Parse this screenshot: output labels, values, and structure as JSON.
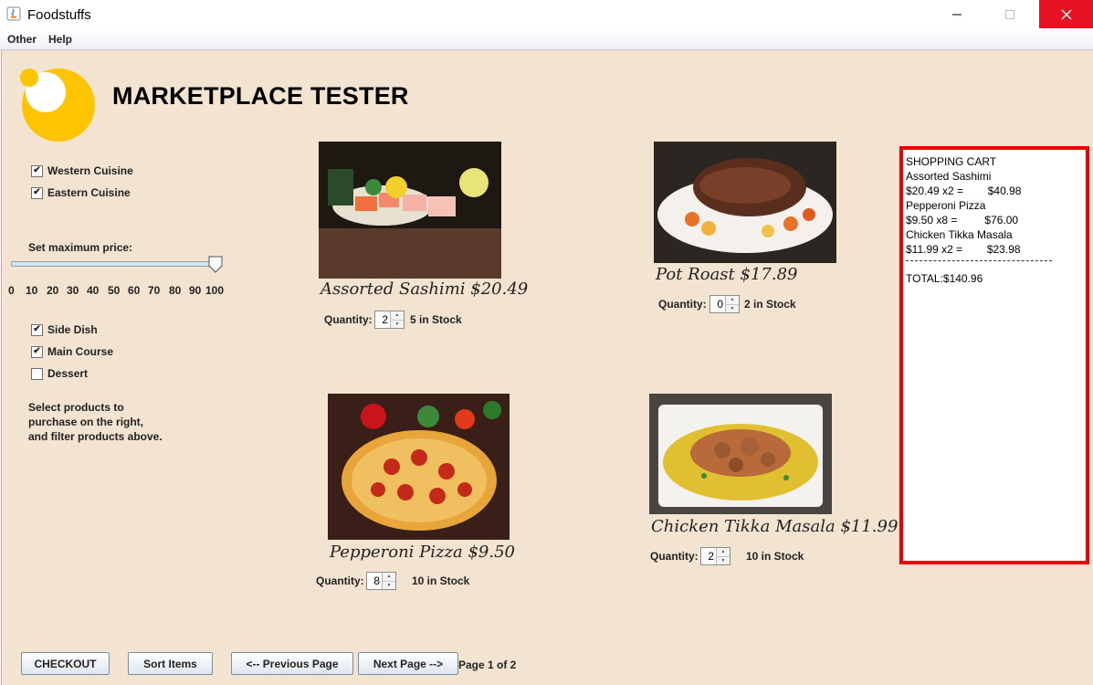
{
  "window": {
    "title": "Foodstuffs"
  },
  "menu": [
    {
      "label": "Other"
    },
    {
      "label": "Help"
    }
  ],
  "header": {
    "title": "MARKETPLACE TESTER"
  },
  "filters": {
    "cuisine": [
      {
        "label": "Western Cuisine",
        "checked": true
      },
      {
        "label": "Eastern Cuisine",
        "checked": true
      }
    ],
    "price_label": "Set maximum price:",
    "price_slider": {
      "min": 0,
      "max": 100,
      "value": 100,
      "ticks": [
        "0",
        "10",
        "20",
        "30",
        "40",
        "50",
        "60",
        "70",
        "80",
        "90",
        "100"
      ]
    },
    "course": [
      {
        "label": "Side Dish",
        "checked": true
      },
      {
        "label": "Main Course",
        "checked": true
      },
      {
        "label": "Dessert",
        "checked": false
      }
    ],
    "help_text": "Select products to\npurchase on the right,\nand filter products above."
  },
  "products": [
    {
      "name": "Assorted Sashimi $20.49",
      "quantity_label": "Quantity:",
      "quantity": "2",
      "stock": "5 in Stock"
    },
    {
      "name": "Pot Roast $17.89",
      "quantity_label": "Quantity:",
      "quantity": "0",
      "stock": "2 in Stock"
    },
    {
      "name": "Pepperoni Pizza $9.50",
      "quantity_label": "Quantity:",
      "quantity": "8",
      "stock": "10 in Stock"
    },
    {
      "name": "Chicken Tikka Masala $11.99",
      "quantity_label": "Quantity:",
      "quantity": "2",
      "stock": "10 in Stock"
    }
  ],
  "cart": {
    "lines": [
      "SHOPPING CART",
      "Assorted Sashimi",
      "$20.49 x2 =        $40.98",
      "Pepperoni Pizza",
      "$9.50 x8 =         $76.00",
      "Chicken Tikka Masala",
      "$11.99 x2 =        $23.98"
    ],
    "total": "TOTAL:$140.96",
    "border_color": "#ee0000"
  },
  "footer": {
    "checkout": "CHECKOUT",
    "sort": "Sort Items",
    "prev": "<-- Previous Page",
    "next": "Next Page -->",
    "page": "Page 1 of 2"
  },
  "colors": {
    "background": "#f3e4d1",
    "logo": "#ffc400",
    "close": "#e81123"
  }
}
